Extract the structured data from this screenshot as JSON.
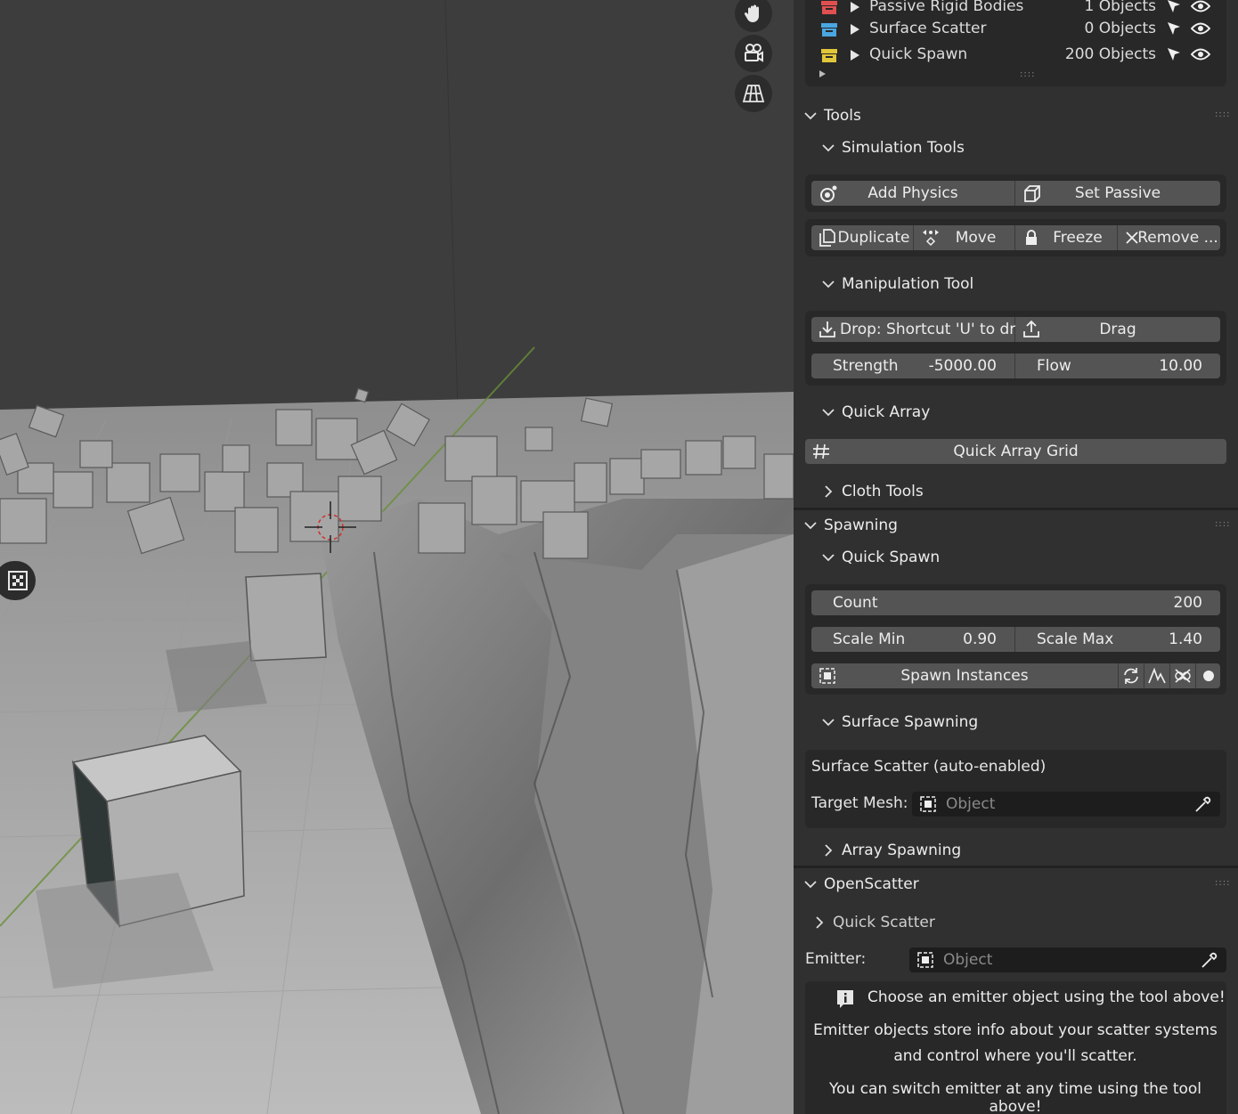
{
  "outliner": {
    "rows": [
      {
        "name": "Passive Rigid Bodies",
        "count": "1 Objects",
        "color": "#e05050"
      },
      {
        "name": "Surface Scatter",
        "count": "0 Objects",
        "color": "#4aa6e0"
      },
      {
        "name": "Quick Spawn",
        "count": "200 Objects",
        "color": "#e0c63a"
      }
    ]
  },
  "tools": {
    "title": "Tools",
    "simulation": {
      "title": "Simulation Tools",
      "add_physics": "Add Physics",
      "set_passive": "Set Passive",
      "duplicate": "Duplicate",
      "move": "Move",
      "freeze": "Freeze",
      "remove": "Remove ..."
    },
    "manipulation": {
      "title": "Manipulation Tool",
      "drop": "Drop: Shortcut 'U' to dr...",
      "drag": "Drag",
      "strength_label": "Strength",
      "strength_value": "-5000.00",
      "flow_label": "Flow",
      "flow_value": "10.00"
    },
    "quick_array": {
      "title": "Quick Array",
      "grid": "Quick Array Grid"
    },
    "cloth": {
      "title": "Cloth Tools"
    }
  },
  "spawning": {
    "title": "Spawning",
    "quick_spawn": {
      "title": "Quick Spawn",
      "count_label": "Count",
      "count_value": "200",
      "scale_min_label": "Scale Min",
      "scale_min_value": "0.90",
      "scale_max_label": "Scale Max",
      "scale_max_value": "1.40",
      "spawn": "Spawn Instances"
    },
    "surface": {
      "title": "Surface Spawning",
      "note": "Surface Scatter (auto-enabled)",
      "target_label": "Target Mesh:",
      "target_placeholder": "Object"
    },
    "array": {
      "title": "Array Spawning"
    }
  },
  "openscatter": {
    "title": "OpenScatter",
    "quick_scatter": "Quick Scatter",
    "emitter_label": "Emitter:",
    "emitter_placeholder": "Object",
    "info1": "Choose an emitter object using the tool above!",
    "info2": "Emitter objects store info about your scatter systems",
    "info3": "and control where you'll scatter.",
    "info4": "You can switch emitter at any time using the tool above!"
  },
  "colors": {
    "panel": "#303030",
    "button": "#545454",
    "box": "#282828",
    "field": "#1d1d1d"
  }
}
